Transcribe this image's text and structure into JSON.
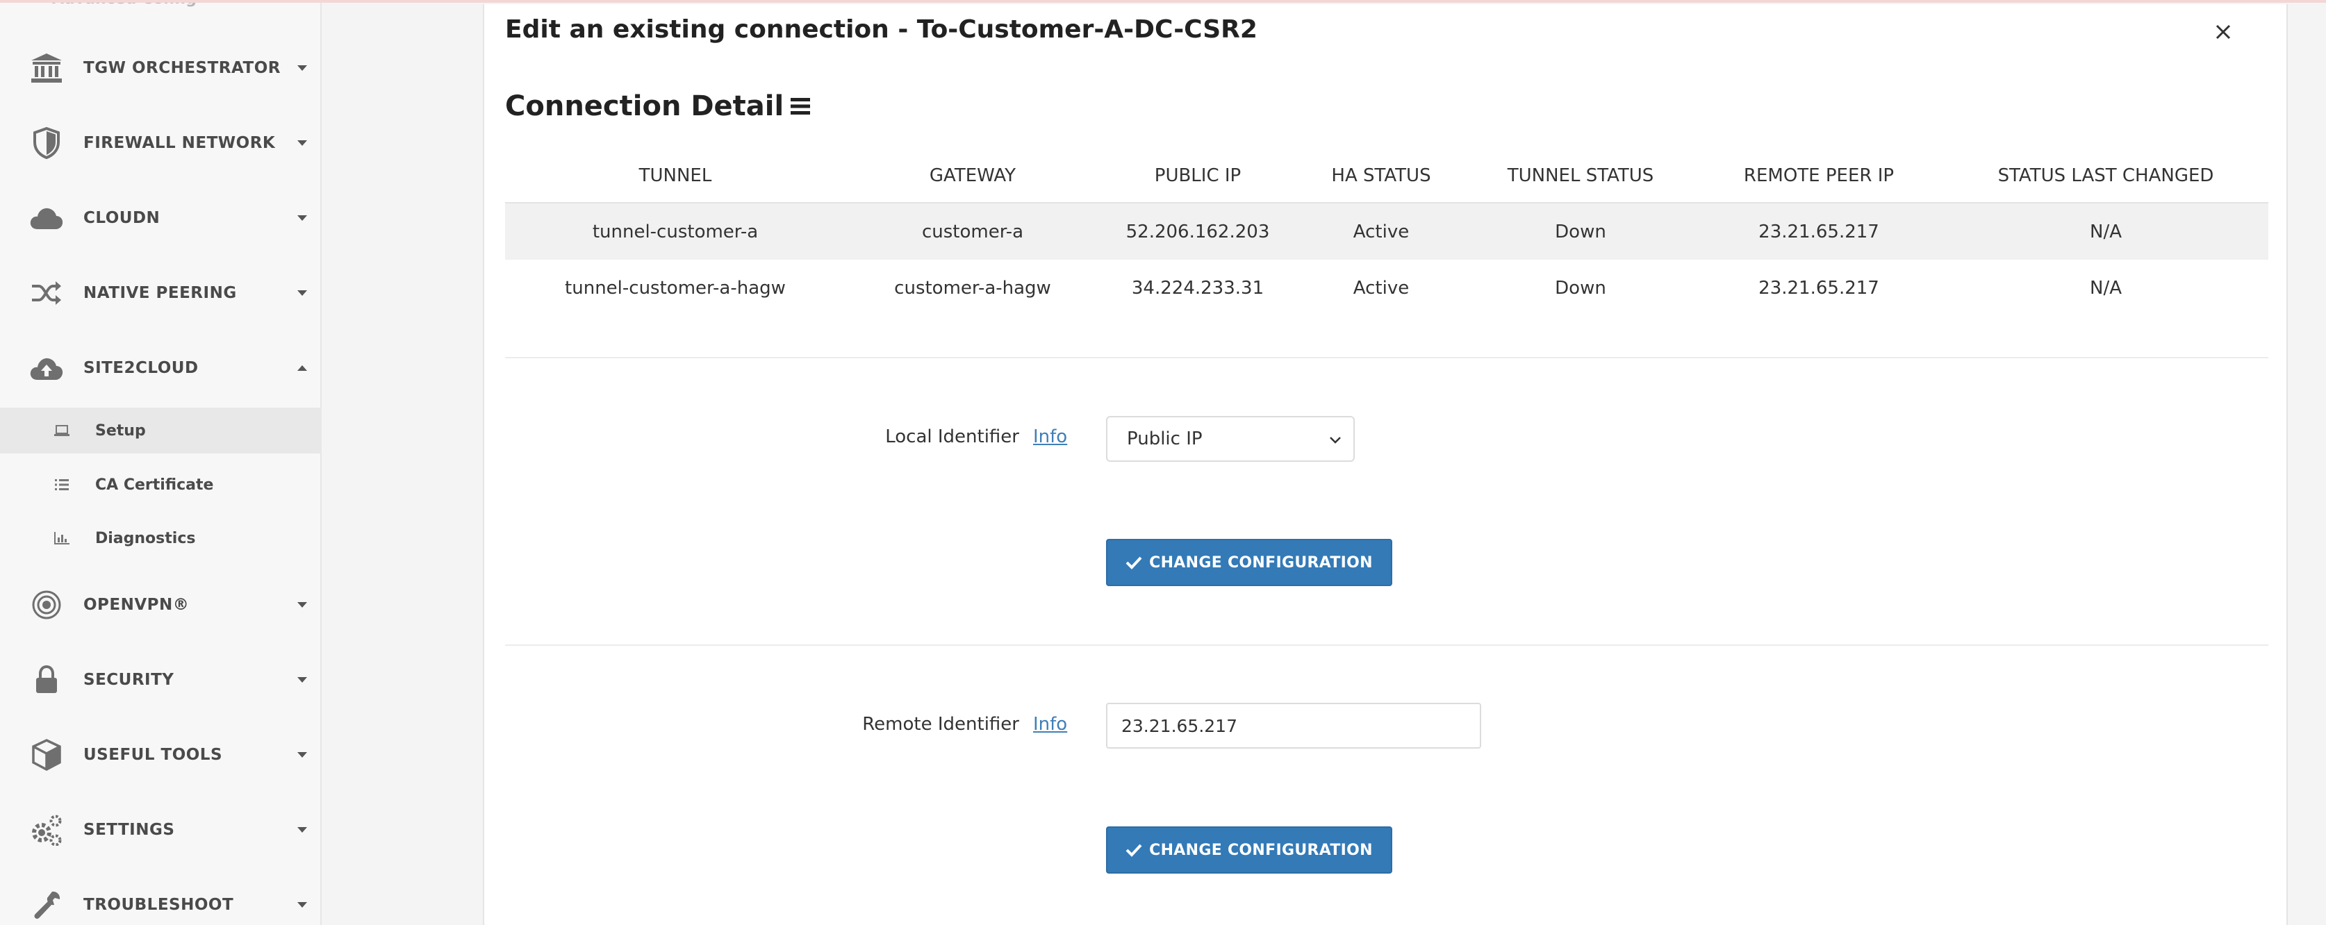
{
  "sidebar": {
    "faded_top_label": "Advanced Config",
    "sections": [
      {
        "label": "TGW ORCHESTRATOR",
        "icon": "bank-icon"
      },
      {
        "label": "FIREWALL NETWORK",
        "icon": "shield-icon"
      },
      {
        "label": "CLOUDN",
        "icon": "cloud-icon"
      },
      {
        "label": "NATIVE PEERING",
        "icon": "shuffle-icon"
      },
      {
        "label": "SITE2CLOUD",
        "icon": "cloud-upload-icon",
        "expanded": true
      },
      {
        "label": "OPENVPN®",
        "icon": "target-icon"
      },
      {
        "label": "SECURITY",
        "icon": "lock-icon"
      },
      {
        "label": "USEFUL TOOLS",
        "icon": "cube-icon"
      },
      {
        "label": "SETTINGS",
        "icon": "gears-icon"
      },
      {
        "label": "TROUBLESHOOT",
        "icon": "wrench-icon"
      }
    ],
    "site2cloud_items": [
      {
        "label": "Setup",
        "icon": "laptop-icon",
        "active": true
      },
      {
        "label": "CA Certificate",
        "icon": "list-icon"
      },
      {
        "label": "Diagnostics",
        "icon": "bar-chart-icon"
      }
    ]
  },
  "dialog": {
    "title": "Edit an existing connection - To-Customer-A-DC-CSR2",
    "section_title": "Connection Detail",
    "table": {
      "headers": [
        "TUNNEL",
        "GATEWAY",
        "PUBLIC IP",
        "HA STATUS",
        "TUNNEL STATUS",
        "REMOTE PEER IP",
        "STATUS LAST CHANGED"
      ],
      "rows": [
        [
          "tunnel-customer-a",
          "customer-a",
          "52.206.162.203",
          "Active",
          "Down",
          "23.21.65.217",
          "N/A"
        ],
        [
          "tunnel-customer-a-hagw",
          "customer-a-hagw",
          "34.224.233.31",
          "Active",
          "Down",
          "23.21.65.217",
          "N/A"
        ]
      ]
    },
    "local_identifier": {
      "label": "Local Identifier",
      "info": "Info",
      "selected": "Public IP",
      "button": "CHANGE CONFIGURATION"
    },
    "remote_identifier": {
      "label": "Remote Identifier",
      "info": "Info",
      "value": "23.21.65.217",
      "button": "CHANGE CONFIGURATION"
    }
  },
  "colors": {
    "primary_button": "#337ab7",
    "link": "#3f7fb8",
    "row_stripe": "#f1f1f1"
  }
}
